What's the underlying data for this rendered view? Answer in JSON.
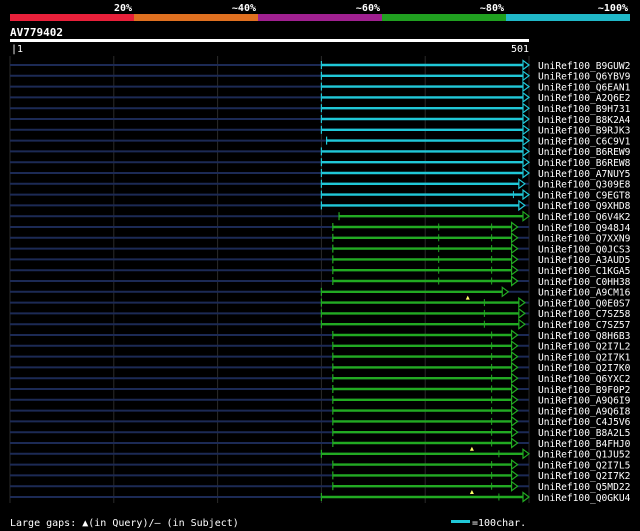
{
  "colors": {
    "background": "#000000",
    "identity_bands": [
      "#e8203a",
      "#e07020",
      "#a02090",
      "#20a020",
      "#20b8c8"
    ],
    "alignment_cyan": "#20c8d8",
    "alignment_green": "#22aa22",
    "gridline": "#2a2a2a",
    "row_line": "#1c2a55"
  },
  "chart_data": {
    "type": "alignment-map",
    "title": "",
    "identity_legend": [
      "20%",
      "~40%",
      "~60%",
      "~80%",
      "~100%"
    ],
    "query": {
      "name": "AV779402",
      "start_label": "|1",
      "end_label": "501",
      "length": 501
    },
    "xlim": [
      1,
      501
    ],
    "x_gridlines": [
      1,
      101,
      201,
      301,
      401,
      501
    ],
    "legend": {
      "gaps_text": "Large gaps: ▲(in Query)/– (in Subject)",
      "scale_text": "=100char."
    },
    "hits": [
      {
        "name": "UniRef100_B9GUW2",
        "start": 301,
        "end": 501,
        "identity": "~100%",
        "ticks": [],
        "gap_marks": []
      },
      {
        "name": "UniRef100_Q6YBV9",
        "start": 301,
        "end": 501,
        "identity": "~100%",
        "ticks": [],
        "gap_marks": []
      },
      {
        "name": "UniRef100_Q6EAN1",
        "start": 301,
        "end": 501,
        "identity": "~100%",
        "ticks": [],
        "gap_marks": []
      },
      {
        "name": "UniRef100_A2Q6E2",
        "start": 301,
        "end": 501,
        "identity": "~100%",
        "ticks": [],
        "gap_marks": []
      },
      {
        "name": "UniRef100_B9H731",
        "start": 301,
        "end": 501,
        "identity": "~100%",
        "ticks": [],
        "gap_marks": []
      },
      {
        "name": "UniRef100_B8K2A4",
        "start": 301,
        "end": 501,
        "identity": "~100%",
        "ticks": [],
        "gap_marks": []
      },
      {
        "name": "UniRef100_B9RJK3",
        "start": 301,
        "end": 501,
        "identity": "~100%",
        "ticks": [],
        "gap_marks": []
      },
      {
        "name": "UniRef100_C6C9V1",
        "start": 306,
        "end": 501,
        "identity": "~100%",
        "ticks": [],
        "gap_marks": []
      },
      {
        "name": "UniRef100_B6REW9",
        "start": 301,
        "end": 501,
        "identity": "~100%",
        "ticks": [],
        "gap_marks": []
      },
      {
        "name": "UniRef100_B6REW8",
        "start": 301,
        "end": 501,
        "identity": "~100%",
        "ticks": [],
        "gap_marks": []
      },
      {
        "name": "UniRef100_A7NUY5",
        "start": 301,
        "end": 501,
        "identity": "~100%",
        "ticks": [],
        "gap_marks": []
      },
      {
        "name": "UniRef100_Q309E8",
        "start": 301,
        "end": 497,
        "identity": "~100%",
        "ticks": [],
        "gap_marks": []
      },
      {
        "name": "UniRef100_C9EGT8",
        "start": 301,
        "end": 501,
        "identity": "~100%",
        "ticks": [
          486
        ],
        "gap_marks": []
      },
      {
        "name": "UniRef100_Q9XHD8",
        "start": 301,
        "end": 497,
        "identity": "~100%",
        "ticks": [],
        "gap_marks": []
      },
      {
        "name": "UniRef100_Q6V4K2",
        "start": 318,
        "end": 501,
        "identity": "~80%",
        "ticks": [],
        "gap_marks": []
      },
      {
        "name": "UniRef100_Q948J4",
        "start": 312,
        "end": 490,
        "identity": "~80%",
        "ticks": [
          414,
          465
        ],
        "gap_marks": []
      },
      {
        "name": "UniRef100_Q7XXN9",
        "start": 312,
        "end": 490,
        "identity": "~80%",
        "ticks": [
          414,
          465
        ],
        "gap_marks": []
      },
      {
        "name": "UniRef100_Q0JCS3",
        "start": 312,
        "end": 490,
        "identity": "~80%",
        "ticks": [
          414,
          465
        ],
        "gap_marks": []
      },
      {
        "name": "UniRef100_A3AUD5",
        "start": 312,
        "end": 490,
        "identity": "~80%",
        "ticks": [
          414,
          465
        ],
        "gap_marks": []
      },
      {
        "name": "UniRef100_C1KGA5",
        "start": 312,
        "end": 490,
        "identity": "~80%",
        "ticks": [
          414,
          465
        ],
        "gap_marks": []
      },
      {
        "name": "UniRef100_C0HH38",
        "start": 312,
        "end": 490,
        "identity": "~80%",
        "ticks": [
          414,
          465
        ],
        "gap_marks": []
      },
      {
        "name": "UniRef100_A9CM16",
        "start": 301,
        "end": 481,
        "identity": "~80%",
        "ticks": [],
        "gap_marks": []
      },
      {
        "name": "UniRef100_Q0E0S7",
        "start": 301,
        "end": 497,
        "identity": "~80%",
        "ticks": [
          458
        ],
        "gap_marks": [
          442
        ]
      },
      {
        "name": "UniRef100_C7SZ58",
        "start": 301,
        "end": 497,
        "identity": "~80%",
        "ticks": [
          458
        ],
        "gap_marks": []
      },
      {
        "name": "UniRef100_C7SZ57",
        "start": 301,
        "end": 497,
        "identity": "~80%",
        "ticks": [
          458
        ],
        "gap_marks": []
      },
      {
        "name": "UniRef100_Q8H6B3",
        "start": 312,
        "end": 490,
        "identity": "~80%",
        "ticks": [
          465
        ],
        "gap_marks": []
      },
      {
        "name": "UniRef100_Q2I7L2",
        "start": 312,
        "end": 490,
        "identity": "~80%",
        "ticks": [
          465
        ],
        "gap_marks": []
      },
      {
        "name": "UniRef100_Q2I7K1",
        "start": 312,
        "end": 490,
        "identity": "~80%",
        "ticks": [
          465
        ],
        "gap_marks": []
      },
      {
        "name": "UniRef100_Q2I7K0",
        "start": 312,
        "end": 490,
        "identity": "~80%",
        "ticks": [
          465
        ],
        "gap_marks": []
      },
      {
        "name": "UniRef100_Q6YXC2",
        "start": 312,
        "end": 490,
        "identity": "~80%",
        "ticks": [
          465
        ],
        "gap_marks": []
      },
      {
        "name": "UniRef100_B9F0P2",
        "start": 312,
        "end": 490,
        "identity": "~80%",
        "ticks": [
          465
        ],
        "gap_marks": []
      },
      {
        "name": "UniRef100_A9Q6I9",
        "start": 312,
        "end": 490,
        "identity": "~80%",
        "ticks": [
          465
        ],
        "gap_marks": []
      },
      {
        "name": "UniRef100_A9Q6I8",
        "start": 312,
        "end": 490,
        "identity": "~80%",
        "ticks": [
          465
        ],
        "gap_marks": []
      },
      {
        "name": "UniRef100_C4J5V6",
        "start": 312,
        "end": 490,
        "identity": "~80%",
        "ticks": [
          465
        ],
        "gap_marks": []
      },
      {
        "name": "UniRef100_B8A2L5",
        "start": 312,
        "end": 490,
        "identity": "~80%",
        "ticks": [
          465
        ],
        "gap_marks": []
      },
      {
        "name": "UniRef100_B4FHJ0",
        "start": 312,
        "end": 490,
        "identity": "~80%",
        "ticks": [
          465
        ],
        "gap_marks": []
      },
      {
        "name": "UniRef100_Q1JU52",
        "start": 301,
        "end": 501,
        "identity": "~80%",
        "ticks": [
          472
        ],
        "gap_marks": [
          446
        ]
      },
      {
        "name": "UniRef100_Q2I7L5",
        "start": 312,
        "end": 490,
        "identity": "~80%",
        "ticks": [
          465
        ],
        "gap_marks": []
      },
      {
        "name": "UniRef100_Q2I7K2",
        "start": 312,
        "end": 490,
        "identity": "~80%",
        "ticks": [
          465
        ],
        "gap_marks": []
      },
      {
        "name": "UniRef100_Q5MD22",
        "start": 312,
        "end": 490,
        "identity": "~80%",
        "ticks": [
          465
        ],
        "gap_marks": []
      },
      {
        "name": "UniRef100_Q0GKU4",
        "start": 301,
        "end": 501,
        "identity": "~80%",
        "ticks": [
          472
        ],
        "gap_marks": [
          446
        ]
      }
    ]
  }
}
